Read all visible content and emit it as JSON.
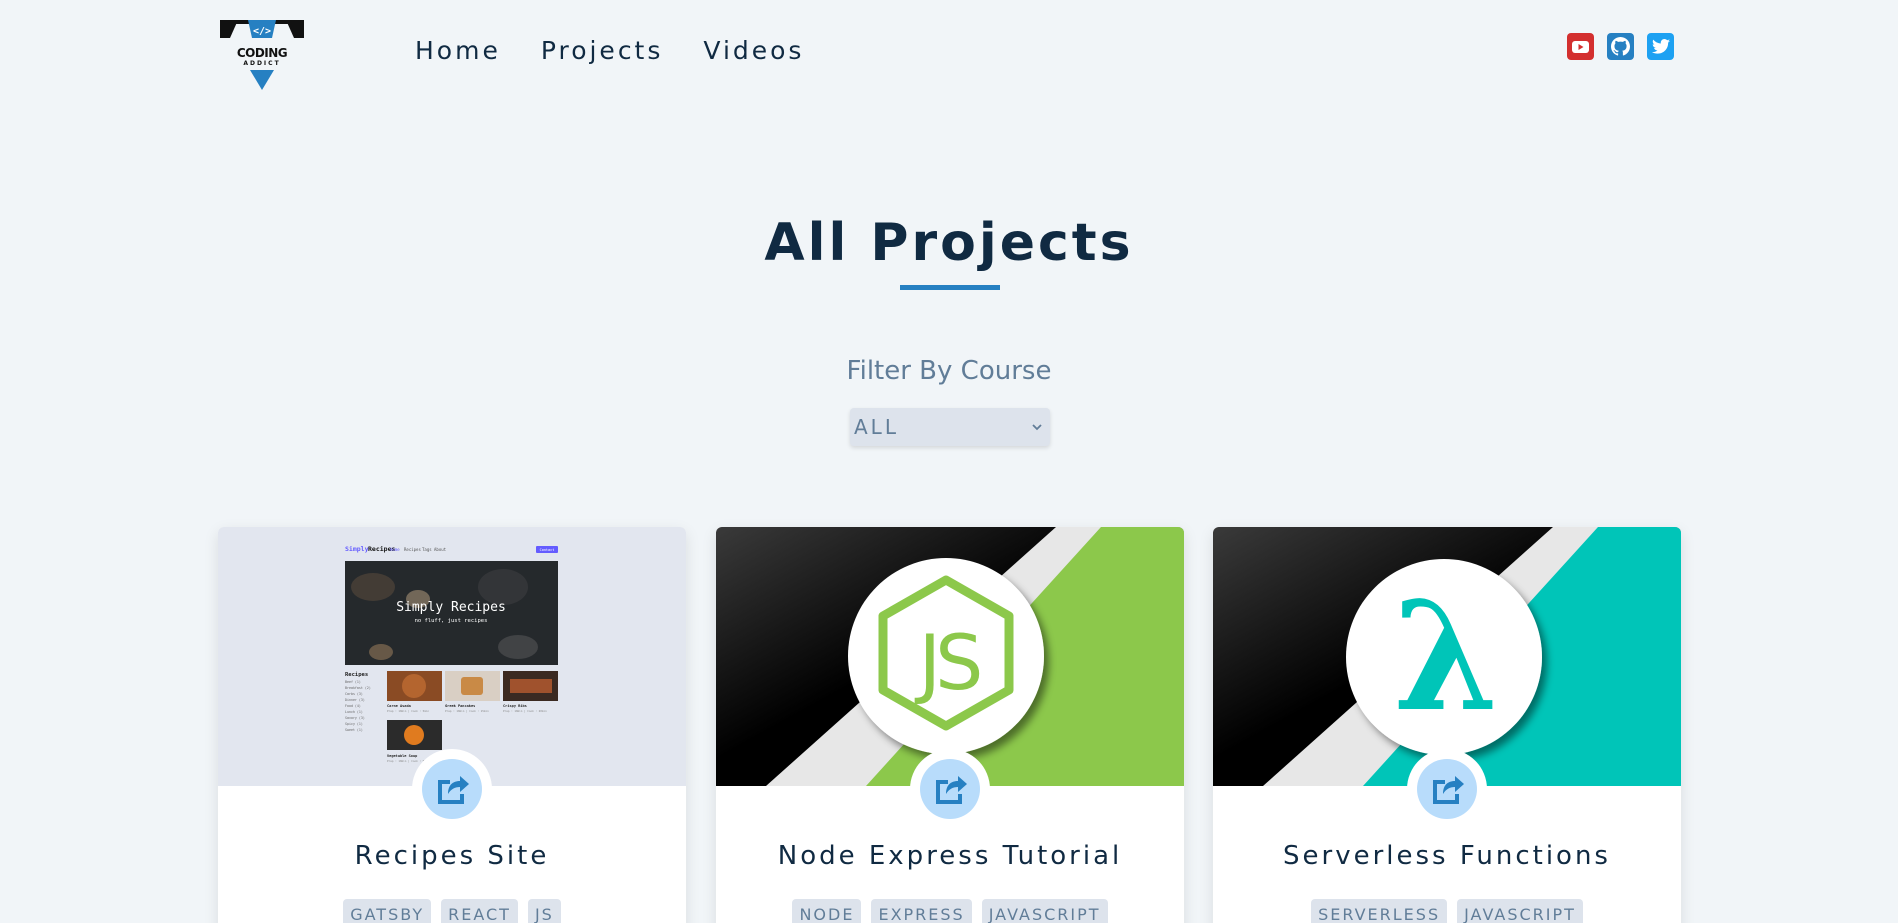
{
  "navbar": {
    "logo_text": "CODING ADDICT",
    "links": [
      "Home",
      "Projects",
      "Videos"
    ],
    "social": [
      {
        "icon": "youtube-icon",
        "color": "#d32f2f"
      },
      {
        "icon": "github-icon",
        "color": "#2680c2"
      },
      {
        "icon": "twitter-icon",
        "color": "#1da1f2"
      }
    ]
  },
  "header": {
    "title": "All Projects",
    "filter_label": "Filter By Course",
    "filter_value": "ALL"
  },
  "colors": {
    "primary": "#2680c2",
    "node_green": "#8cc84b",
    "serverless_teal": "#00c5b8",
    "background": "#f1f5f8"
  },
  "projects": [
    {
      "title": "Recipes Site",
      "tags": [
        "GATSBY",
        "REACT",
        "JS"
      ],
      "thumb": {
        "brand": "Simply",
        "brand2": "Recipes",
        "nav": [
          "Home",
          "Recipes",
          "Tags",
          "About"
        ],
        "cta": "Contact",
        "hero_title": "Simply Recipes",
        "hero_sub": "no fluff, just recipes",
        "sidebar_title": "Recipes",
        "sidebar_items": [
          "Beef (1)",
          "Breakfast (2)",
          "Carbs (3)",
          "Dinner (3)",
          "Food (4)",
          "Lunch (1)",
          "Savory (3)",
          "Spicy (1)",
          "Sweet (1)"
        ],
        "recipes": [
          {
            "name": "Carne Asada",
            "meta": "Prep : 10min | Cook : 5min"
          },
          {
            "name": "Greek Pancakes",
            "meta": "Prep : 10min | Cook : 15min"
          },
          {
            "name": "Crispy Ribs",
            "meta": "Prep : 10min | Cook : 20min"
          },
          {
            "name": "Vegetable Soup",
            "meta": "Prep : 10min | Cook : 5min"
          }
        ]
      }
    },
    {
      "title": "Node Express Tutorial",
      "tags": [
        "NODE",
        "EXPRESS",
        "JAVASCRIPT"
      ],
      "thumb": {
        "logo_text": "JS"
      }
    },
    {
      "title": "Serverless Functions",
      "tags": [
        "SERVERLESS",
        "JAVASCRIPT"
      ],
      "thumb": {
        "logo_text": "λ"
      }
    }
  ]
}
